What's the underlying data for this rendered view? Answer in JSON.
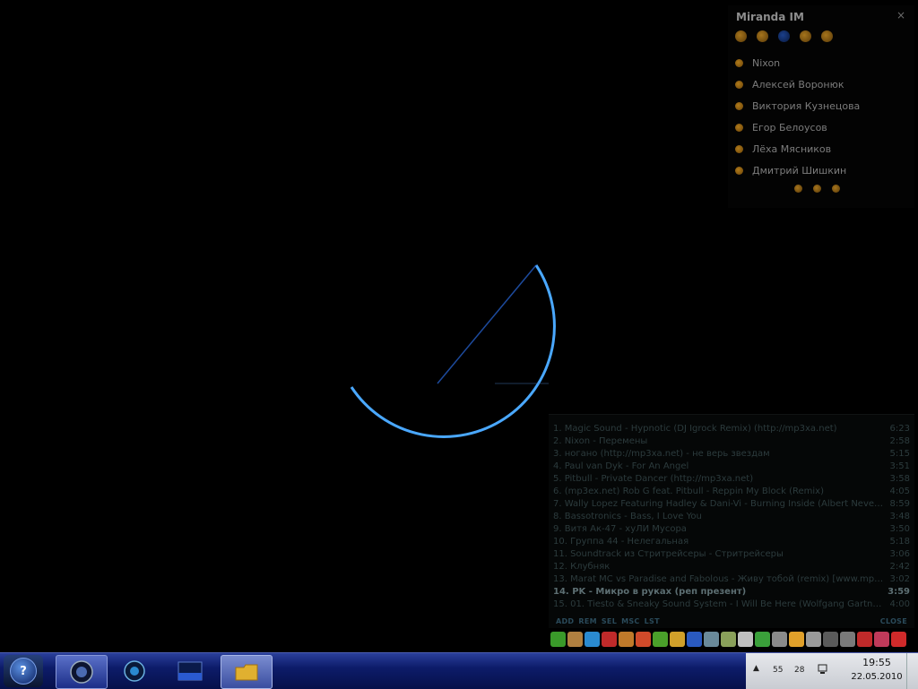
{
  "miranda": {
    "title": "Miranda IM",
    "close": "×",
    "toolbar": [
      "groups-icon",
      "options-icon",
      "status-icon",
      "contacts-icon",
      "menu-icon"
    ],
    "contacts": [
      {
        "name": "Nixon"
      },
      {
        "name": "Алексей Воронюк"
      },
      {
        "name": "Виктория Кузнецова"
      },
      {
        "name": "Егор Белоусов"
      },
      {
        "name": "Лёха Мясников"
      },
      {
        "name": "Дмитрий Шишкин"
      }
    ]
  },
  "playlist": {
    "tracks": [
      {
        "title": "1. Magic Sound - Hypnotic (DJ Igrock Remix) (http://mp3xa.net)",
        "time": "6:23"
      },
      {
        "title": "2. Nixon - Перемены",
        "time": "2:58"
      },
      {
        "title": "3. ногано (http://mp3xa.net) - не верь звездам",
        "time": "5:15"
      },
      {
        "title": "4. Paul van Dyk - For An Angel",
        "time": "3:51"
      },
      {
        "title": "5. Pitbull - Private Dancer (http://mp3xa.net)",
        "time": "3:58"
      },
      {
        "title": "6. (mp3ex.net) Rob G feat. Pitbull - Reppin My Block (Remix)",
        "time": "4:05"
      },
      {
        "title": "7. Wally Lopez Featuring Hadley & Dani-Vi - Burning Inside (Albert Neve Remix)",
        "time": "8:59"
      },
      {
        "title": "8. Bassotronics - Bass, I Love You",
        "time": "3:48"
      },
      {
        "title": "9. Витя Ак-47 - хуЛИ Мусора",
        "time": "3:50"
      },
      {
        "title": "10. Группа 44 - Нелегальная",
        "time": "5:18"
      },
      {
        "title": "11. Soundtrack из Стритрейсеры - Стритрейсеры",
        "time": "3:06"
      },
      {
        "title": "12. Клубняк",
        "time": "2:42"
      },
      {
        "title": "13. Marat MC vs Paradise and Fabolous - Живу тобой (remix) [www.mp3ex.net]",
        "time": "3:02"
      },
      {
        "title": "14. PK - Микро в руках (реп презент)",
        "time": "3:59",
        "current": true
      },
      {
        "title": "15. 01. Tiesto & Sneaky Sound System - I Will Be Here (Wolfgang Gartner Remix)",
        "time": "4:00"
      }
    ],
    "buttons": [
      "ADD",
      "REM",
      "SEL",
      "MSC",
      "LST"
    ],
    "close": "CLOSE"
  },
  "quicklaunch": [
    {
      "icon": "utorrent-icon",
      "color": "#3a9a2a"
    },
    {
      "icon": "tool-icon",
      "color": "#b08040"
    },
    {
      "icon": "skype-icon",
      "color": "#2a8ad0"
    },
    {
      "icon": "antivirus-icon",
      "color": "#c02a2a"
    },
    {
      "icon": "archive-icon",
      "color": "#c07a2a"
    },
    {
      "icon": "gift-icon",
      "color": "#d04a2a"
    },
    {
      "icon": "download-icon",
      "color": "#4aa02a"
    },
    {
      "icon": "burn-icon",
      "color": "#d0a02a"
    },
    {
      "icon": "disk-icon",
      "color": "#2a5ac0"
    },
    {
      "icon": "monitor-icon",
      "color": "#6a8a9a"
    },
    {
      "icon": "photo-icon",
      "color": "#8aa05a"
    },
    {
      "icon": "edit-icon",
      "color": "#c0c0c0"
    },
    {
      "icon": "mp3cut-icon",
      "color": "#3aa03a"
    },
    {
      "icon": "disc-icon",
      "color": "#8a8a8a"
    },
    {
      "icon": "info-icon",
      "color": "#e0a02a"
    },
    {
      "icon": "hammer-icon",
      "color": "#9a9a9a"
    },
    {
      "icon": "steam-icon",
      "color": "#5a5a5a"
    },
    {
      "icon": "drive-icon",
      "color": "#7a7a7a"
    },
    {
      "icon": "plane-icon",
      "color": "#c02a2a"
    },
    {
      "icon": "cards-icon",
      "color": "#c03a5a"
    },
    {
      "icon": "book-icon",
      "color": "#d02a2a"
    }
  ],
  "taskbar": {
    "start_label": "?",
    "tray": {
      "num1": "55",
      "num2": "28",
      "time": "19:55",
      "date": "22.05.2010"
    }
  }
}
